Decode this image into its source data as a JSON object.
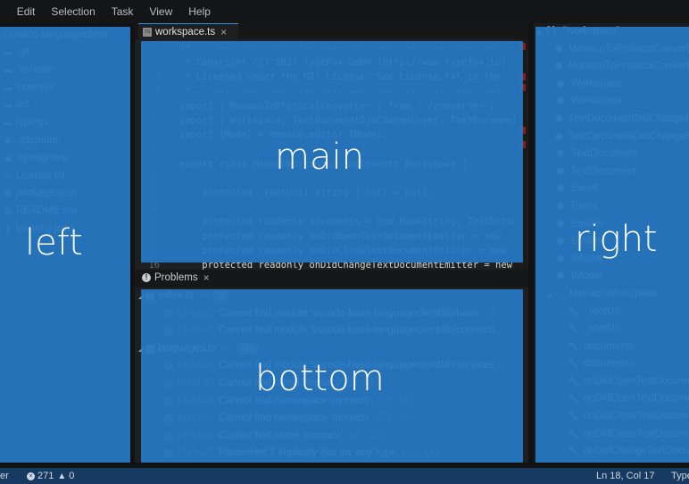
{
  "menubar": {
    "items": [
      "e",
      "Edit",
      "Selection",
      "Task",
      "View",
      "Help"
    ]
  },
  "left": {
    "root_label": "monaco-languageclient",
    "items": [
      {
        "icon": "folder-icon",
        "label": ".git"
      },
      {
        "icon": "folder-icon",
        "label": ".vscode"
      },
      {
        "icon": "folder-icon",
        "label": "example"
      },
      {
        "icon": "folder-icon",
        "label": "src"
      },
      {
        "icon": "folder-icon",
        "label": "typings"
      },
      {
        "icon": "git-icon",
        "label": ".gitignore"
      },
      {
        "icon": "npm-icon",
        "label": ".npmignore"
      },
      {
        "icon": "text-file-icon",
        "label": "License.txt"
      },
      {
        "icon": "json-icon",
        "label": "package.json"
      },
      {
        "icon": "markdown-icon",
        "label": "README.md"
      },
      {
        "icon": "file-icon",
        "label": "tsconfig.json"
      }
    ],
    "overlay_label": "left"
  },
  "editor": {
    "tab_label": "workspace.ts",
    "tab_icon_text": "TS",
    "lines": [
      {
        "n": "1",
        "code": "/* ------------------------------------------------------------"
      },
      {
        "n": "2",
        "code": " * Copyright (c) 2017 TypeFox GmbH (http://www.typefox.io)"
      },
      {
        "n": "3",
        "code": " * Licensed under the MIT License. See License.txt in the"
      },
      {
        "n": "4",
        "code": " * ------------------------------------------------------------"
      },
      {
        "n": "5",
        "code": "import { MonacoToProtocolConverter } from './converter';"
      },
      {
        "n": "6",
        "code": "import { Workspace, TextDocumentDidChangeEvent, TextDocument"
      },
      {
        "n": "7",
        "code": "import IModel = monaco.editor.IModel;"
      },
      {
        "n": "8",
        "code": ""
      },
      {
        "n": "9",
        "code": "export class MonacoWorkspace implements Workspace {"
      },
      {
        "n": "10",
        "code": ""
      },
      {
        "n": "11",
        "code": "    protected _rootUri: string | null = null;"
      },
      {
        "n": "12",
        "code": ""
      },
      {
        "n": "13",
        "code": "    protected readonly documents = new Map<string, TextDocument"
      },
      {
        "n": "14",
        "code": "    protected readonly onDidOpenTextDocumentEmitter = new"
      },
      {
        "n": "15",
        "code": "    protected readonly onDidCloseTextDocumentEmitter = new"
      },
      {
        "n": "16",
        "code": "    protected readonly onDidChangeTextDocumentEmitter = new"
      }
    ],
    "overlay_label": "main"
  },
  "problems": {
    "tab_label": "Problems",
    "rows": [
      {
        "type": "file",
        "name": "index.ts",
        "dir": "src",
        "count": "2"
      },
      {
        "type": "error",
        "source": "[default]",
        "message": "Cannot find module 'vscode-base-languageclient/lib/base'.",
        "pos": "(1…"
      },
      {
        "type": "error",
        "source": "[default]",
        "message": "Cannot find module 'vscode-base-languageclient/lib/connecti…",
        "pos": ""
      },
      {
        "type": "file",
        "name": "languages.ts",
        "dir": "src",
        "count": "110"
      },
      {
        "type": "error",
        "source": "[default]",
        "message": "Cannot find module 'vscode-base-languageclient/lib/services'…",
        "pos": ""
      },
      {
        "type": "error",
        "source": "[default]",
        "message": "Cannot find name 'monaco'.",
        "pos": "(?, 4)"
      },
      {
        "type": "error",
        "source": "[default]",
        "message": "Cannot find namespace 'monaco'.",
        "pos": "(15, 14)"
      },
      {
        "type": "error",
        "source": "[default]",
        "message": "Cannot find namespace 'monaco'.",
        "pos": "(29, 38)"
      },
      {
        "type": "error",
        "source": "[default]",
        "message": "Cannot find name 'monaco'.",
        "pos": "(47, 28)"
      },
      {
        "type": "error",
        "source": "[default]",
        "message": "Parameter 'l' implicitly has an 'any' type.",
        "pos": "(47, 64)"
      }
    ],
    "overlay_label": "bottom"
  },
  "outline": {
    "root_label": "\"workspace\"",
    "items": [
      {
        "level": 1,
        "icon": "module-icon",
        "label": "MonacoToProtocolConverter"
      },
      {
        "level": 1,
        "icon": "module-icon",
        "label": "MonacoToProtocolConverter"
      },
      {
        "level": 1,
        "icon": "module-icon",
        "label": "Workspace"
      },
      {
        "level": 1,
        "icon": "module-icon",
        "label": "Workspace"
      },
      {
        "level": 1,
        "icon": "module-icon",
        "label": "TextDocumentDidChangeEvent"
      },
      {
        "level": 1,
        "icon": "module-icon",
        "label": "TextDocumentDidChangeEvent"
      },
      {
        "level": 1,
        "icon": "module-icon",
        "label": "TextDocument"
      },
      {
        "level": 1,
        "icon": "module-icon",
        "label": "TextDocument"
      },
      {
        "level": 1,
        "icon": "module-icon",
        "label": "Event"
      },
      {
        "level": 1,
        "icon": "module-icon",
        "label": "Event"
      },
      {
        "level": 1,
        "icon": "module-icon",
        "label": "Emitter"
      },
      {
        "level": 1,
        "icon": "module-icon",
        "label": "Emitter"
      },
      {
        "level": 1,
        "icon": "module-icon",
        "label": "IModel"
      },
      {
        "level": 1,
        "icon": "module-icon",
        "label": "IModel"
      },
      {
        "level": 1,
        "icon": "class-icon",
        "label": "MonacoWorkspace",
        "expandable": true
      },
      {
        "level": 2,
        "icon": "property-icon",
        "label": "_rootUri"
      },
      {
        "level": 2,
        "icon": "property-icon",
        "label": "_rootUri"
      },
      {
        "level": 2,
        "icon": "property-icon",
        "label": "documents"
      },
      {
        "level": 2,
        "icon": "property-icon",
        "label": "documents"
      },
      {
        "level": 2,
        "icon": "property-icon",
        "label": "onDidOpenTextDocumentEmitter"
      },
      {
        "level": 2,
        "icon": "property-icon",
        "label": "onDidOpenTextDocumentEmitter"
      },
      {
        "level": 2,
        "icon": "property-icon",
        "label": "onDidCloseTextDocumentEmitter"
      },
      {
        "level": 2,
        "icon": "property-icon",
        "label": "onDidCloseTextDocumentEmitter"
      },
      {
        "level": 2,
        "icon": "property-icon",
        "label": "onDidChangeTextDocumentEmitter"
      }
    ],
    "overlay_label": "right"
  },
  "statusbar": {
    "left_text": "er",
    "errors": "271",
    "warnings": "0",
    "position": "Ln 18, Col 17",
    "language": "TypeScript"
  },
  "colors": {
    "overlay": "#2678c4",
    "statusbar": "#163a61",
    "background": "#1e1f20"
  }
}
